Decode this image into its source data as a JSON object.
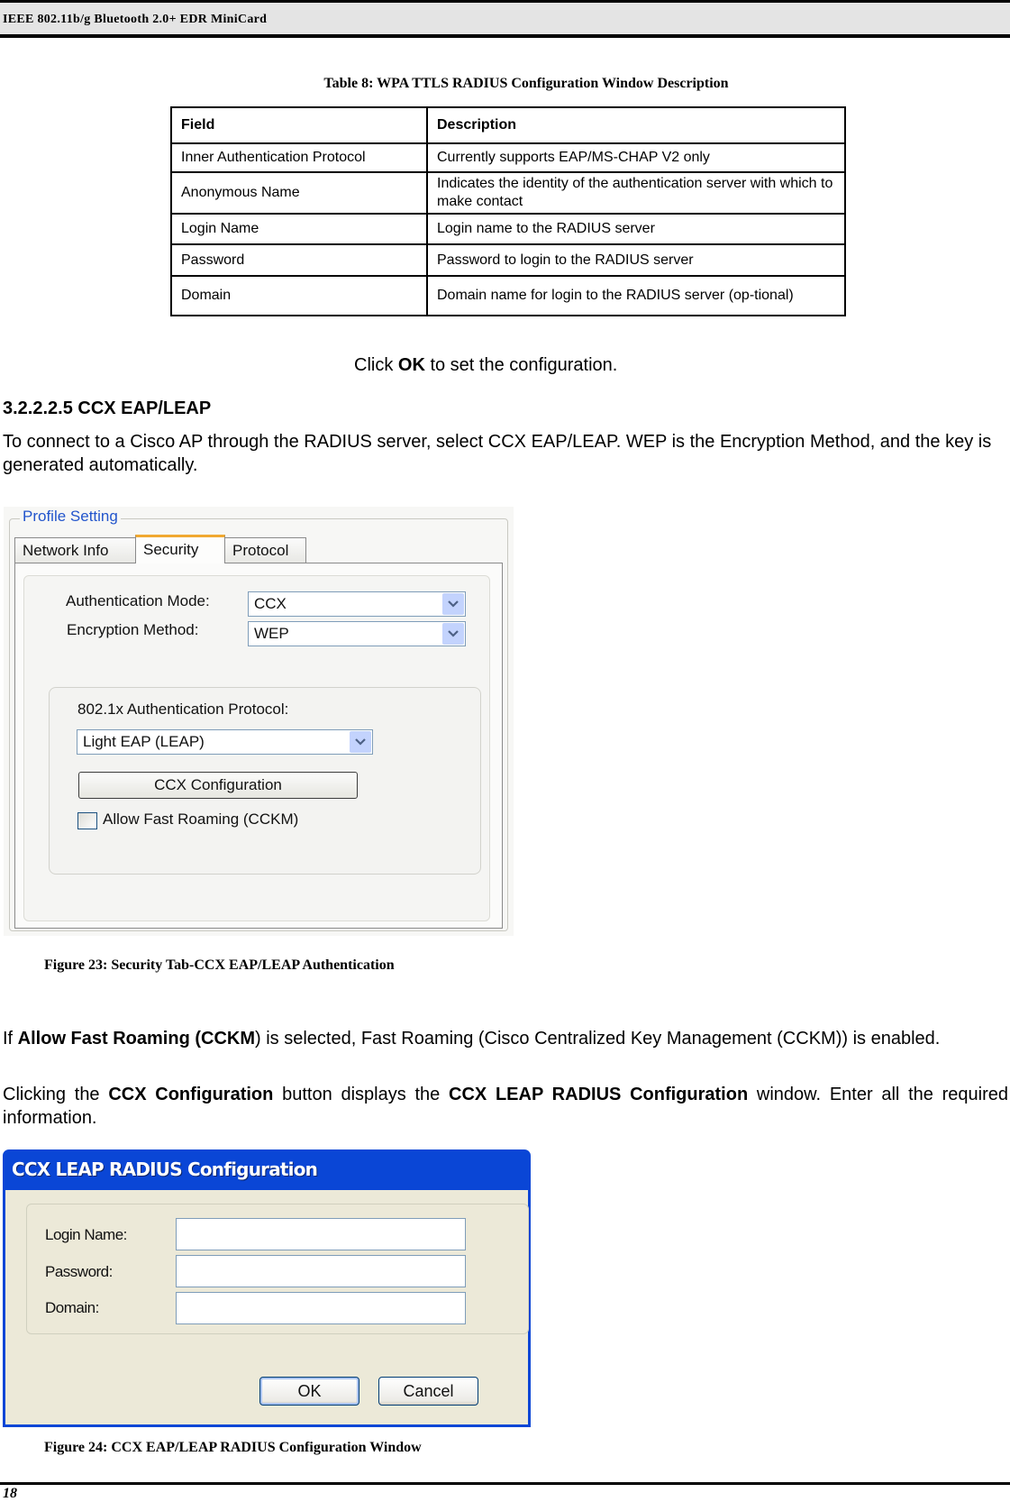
{
  "header": {
    "title": "IEEE 802.11b/g Bluetooth 2.0+ EDR MiniCard"
  },
  "table8": {
    "caption": "Table 8: WPA TTLS RADIUS Configuration Window Description",
    "columns": [
      "Field",
      "Description"
    ],
    "rows": [
      [
        "Inner Authentication Protocol",
        "Currently supports EAP/MS-CHAP V2 only"
      ],
      [
        "Anonymous Name",
        "Indicates the identity of the authentication server with which to make contact"
      ],
      [
        "Login Name",
        "Login name to the RADIUS server"
      ],
      [
        "Password",
        "Password to login to the RADIUS server"
      ],
      [
        "Domain",
        "Domain name for login to the RADIUS server (op-tional)"
      ]
    ]
  },
  "click_ok": {
    "pre": "Click ",
    "bold": "OK",
    "post": " to set the configuration."
  },
  "section": {
    "heading": "3.2.2.2.5 CCX EAP/LEAP",
    "body": "To connect to a Cisco AP through the RADIUS server, select CCX EAP/LEAP. WEP is the Encryption Method, and the key is generated automatically."
  },
  "profile_setting": {
    "legend": "Profile Setting",
    "tabs": [
      {
        "label": "Network Info",
        "active": false
      },
      {
        "label": "Security",
        "active": true
      },
      {
        "label": "Protocol",
        "active": false
      }
    ],
    "auth_mode_label": "Authentication Mode:",
    "auth_mode_value": "CCX",
    "encryption_label": "Encryption Method:",
    "encryption_value": "WEP",
    "protocol_label": "802.1x Authentication Protocol:",
    "protocol_value": "Light EAP (LEAP)",
    "ccx_button": "CCX Configuration",
    "fast_roaming_label": "Allow Fast Roaming (CCKM)",
    "fast_roaming_checked": false
  },
  "figure23": {
    "caption": "Figure 23: Security Tab-CCX EAP/LEAP Authentication"
  },
  "para_roaming": {
    "pre": "If ",
    "bold": "Allow Fast Roaming (CCKM",
    "post": ") is selected, Fast Roaming (Cisco Centralized Key Management (CCKM)) is enabled."
  },
  "para_clicking": {
    "p1": "Clicking the ",
    "b1": "CCX Configuration",
    "p2": " button displays the ",
    "b2": "CCX LEAP RADIUS Configuration",
    "p3": " window. Enter all the required information."
  },
  "ccx_dialog": {
    "title": "CCX LEAP RADIUS Configuration",
    "login_label": "Login Name:",
    "login_value": "",
    "password_label": "Password:",
    "password_value": "",
    "domain_label": "Domain:",
    "domain_value": "",
    "ok": "OK",
    "cancel": "Cancel"
  },
  "figure24": {
    "caption": "Figure 24: CCX EAP/LEAP RADIUS Configuration Window"
  },
  "footer": {
    "page_number": "18"
  }
}
